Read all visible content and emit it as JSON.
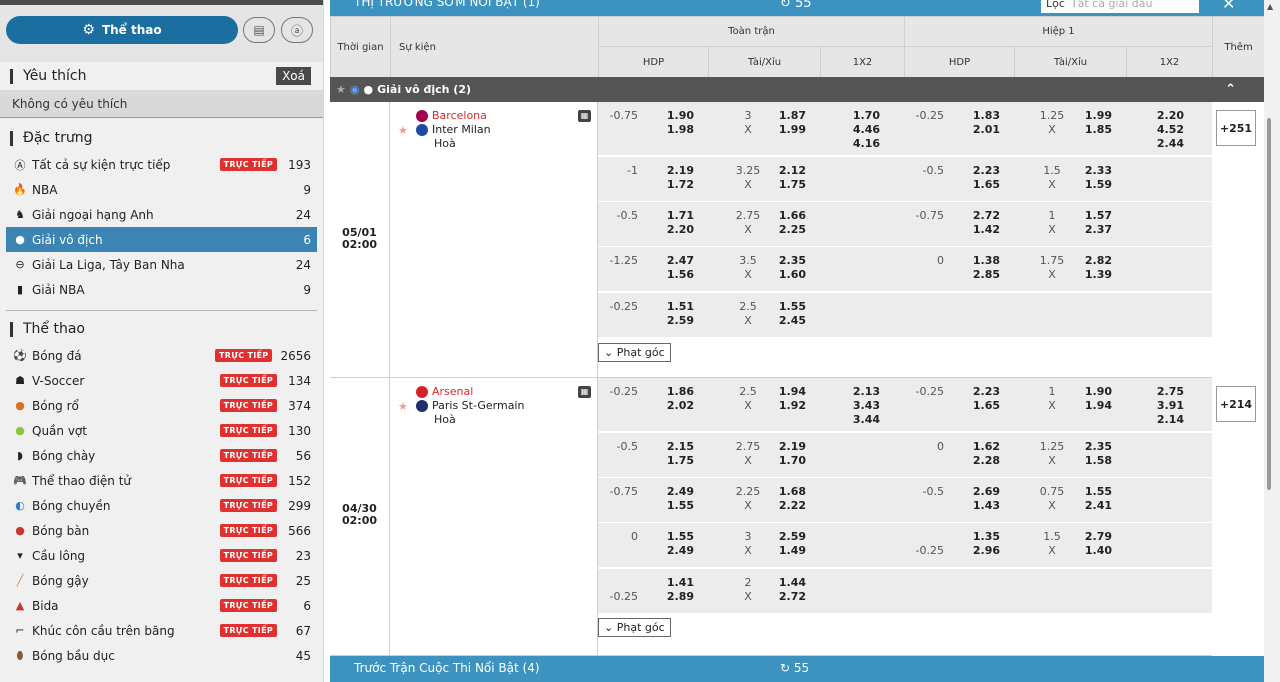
{
  "sidebar": {
    "sports_label": "Thể thao",
    "favorites_title": "Yêu thích",
    "clear_label": "Xoá",
    "no_favorites": "Không có yêu thích",
    "featured_title": "Đặc trưng",
    "featured": [
      {
        "label": "Tất cả sự kiện trực tiếp",
        "live": "TRỰC TIẾP",
        "count": "193",
        "icon": "all-icon"
      },
      {
        "label": "NBA",
        "count": "9",
        "icon": "nba-fire-icon"
      },
      {
        "label": "Giải ngoại hạng Anh",
        "count": "24",
        "icon": "premier-league-icon"
      },
      {
        "label": "Giải vô địch",
        "count": "6",
        "icon": "champions-league-icon",
        "active": true
      },
      {
        "label": "Giải La Liga, Tây Ban Nha",
        "count": "24",
        "icon": "laliga-icon"
      },
      {
        "label": "Giải NBA",
        "count": "9",
        "icon": "nba-logo-icon"
      }
    ],
    "sports_title": "Thể thao",
    "sports": [
      {
        "label": "Bóng đá",
        "live": "TRỰC TIẾP",
        "count": "2656",
        "icon": "soccer-ball-icon"
      },
      {
        "label": "V-Soccer",
        "live": "TRỰC TIẾP",
        "count": "134",
        "icon": "virtual-soccer-icon"
      },
      {
        "label": "Bóng rổ",
        "live": "TRỰC TIẾP",
        "count": "374",
        "icon": "basketball-icon"
      },
      {
        "label": "Quần vợt",
        "live": "TRỰC TIẾP",
        "count": "130",
        "icon": "tennis-ball-icon"
      },
      {
        "label": "Bóng chày",
        "live": "TRỰC TIẾP",
        "count": "56",
        "icon": "baseball-icon"
      },
      {
        "label": "Thể thao điện tử",
        "live": "TRỰC TIẾP",
        "count": "152",
        "icon": "gamepad-icon"
      },
      {
        "label": "Bóng chuyền",
        "live": "TRỰC TIẾP",
        "count": "299",
        "icon": "volleyball-icon"
      },
      {
        "label": "Bóng bàn",
        "live": "TRỰC TIẾP",
        "count": "566",
        "icon": "table-tennis-icon"
      },
      {
        "label": "Cầu lông",
        "live": "TRỰC TIẾP",
        "count": "23",
        "icon": "shuttlecock-icon"
      },
      {
        "label": "Bóng gậy",
        "live": "TRỰC TIẾP",
        "count": "25",
        "icon": "cricket-icon"
      },
      {
        "label": "Bida",
        "live": "TRỰC TIẾP",
        "count": "6",
        "icon": "billiards-icon"
      },
      {
        "label": "Khúc côn cầu trên băng",
        "live": "TRỰC TIẾP",
        "count": "67",
        "icon": "ice-hockey-icon"
      },
      {
        "label": "Bóng bầu dục",
        "count": "45",
        "icon": "rugby-ball-icon"
      }
    ]
  },
  "header": {
    "market_title": "THỊ TRƯỜNG SỚM NỔI BẬT (1)",
    "refresh_count": "55",
    "filter_label": "Lọc",
    "filter_placeholder": "Tất cả giải đấu",
    "col_time": "Thời gian",
    "col_event": "Sự kiện",
    "col_fulltime": "Toàn trận",
    "col_half1": "Hiệp 1",
    "col_more": "Thêm",
    "sub_hdp": "HDP",
    "sub_ou": "Tài/Xỉu",
    "sub_1x2": "1X2"
  },
  "league": {
    "name": "Giải vô địch (2)"
  },
  "matches": [
    {
      "date": "05/01",
      "time": "02:00",
      "home": "Barcelona",
      "away": "Inter Milan",
      "draw": "Hoà",
      "more": "+251",
      "corner": "Phạt góc",
      "rows": [
        {
          "ft_hdp": "-0.75",
          "ft_h1": "1.90",
          "ft_h2": "1.98",
          "ft_ou": "3",
          "ft_x": "X",
          "ft_o1": "1.87",
          "ft_o2": "1.99",
          "ft_1": "1.70",
          "ft_2": "4.46",
          "ft_3": "4.16",
          "h1_hdp": "-0.25",
          "h1_h1": "1.83",
          "h1_h2": "2.01",
          "h1_ou": "1.25",
          "h1_x": "X",
          "h1_o1": "1.99",
          "h1_o2": "1.85",
          "h1_1": "2.20",
          "h1_2": "4.52",
          "h1_3": "2.44"
        },
        {
          "ft_hdp": "-1",
          "ft_h1": "2.19",
          "ft_h2": "1.72",
          "ft_ou": "3.25",
          "ft_x": "X",
          "ft_o1": "2.12",
          "ft_o2": "1.75",
          "h1_hdp": "-0.5",
          "h1_h1": "2.23",
          "h1_h2": "1.65",
          "h1_ou": "1.5",
          "h1_x": "X",
          "h1_o1": "2.33",
          "h1_o2": "1.59"
        },
        {
          "ft_hdp": "-0.5",
          "ft_h1": "1.71",
          "ft_h2": "2.20",
          "ft_ou": "2.75",
          "ft_x": "X",
          "ft_o1": "1.66",
          "ft_o2": "2.25",
          "h1_hdp": "-0.75",
          "h1_h1": "2.72",
          "h1_h2": "1.42",
          "h1_ou": "1",
          "h1_x": "X",
          "h1_o1": "1.57",
          "h1_o2": "2.37"
        },
        {
          "ft_hdp": "-1.25",
          "ft_h1": "2.47",
          "ft_h2": "1.56",
          "ft_ou": "3.5",
          "ft_x": "X",
          "ft_o1": "2.35",
          "ft_o2": "1.60",
          "h1_hdp": "0",
          "h1_h1": "1.38",
          "h1_h2": "2.85",
          "h1_ou": "1.75",
          "h1_x": "X",
          "h1_o1": "2.82",
          "h1_o2": "1.39"
        },
        {
          "ft_hdp": "-0.25",
          "ft_h1": "1.51",
          "ft_h2": "2.59",
          "ft_ou": "2.5",
          "ft_x": "X",
          "ft_o1": "1.55",
          "ft_o2": "2.45"
        }
      ]
    },
    {
      "date": "04/30",
      "time": "02:00",
      "home": "Arsenal",
      "away": "Paris St-Germain",
      "draw": "Hoà",
      "more": "+214",
      "corner": "Phạt góc",
      "rows": [
        {
          "ft_hdp": "-0.25",
          "ft_h1": "1.86",
          "ft_h2": "2.02",
          "ft_ou": "2.5",
          "ft_x": "X",
          "ft_o1": "1.94",
          "ft_o2": "1.92",
          "ft_1": "2.13",
          "ft_2": "3.43",
          "ft_3": "3.44",
          "h1_hdp": "-0.25",
          "h1_h1": "2.23",
          "h1_h2": "1.65",
          "h1_ou": "1",
          "h1_x": "X",
          "h1_o1": "1.90",
          "h1_o2": "1.94",
          "h1_1": "2.75",
          "h1_2": "3.91",
          "h1_3": "2.14"
        },
        {
          "ft_hdp": "-0.5",
          "ft_h1": "2.15",
          "ft_h2": "1.75",
          "ft_ou": "2.75",
          "ft_x": "X",
          "ft_o1": "2.19",
          "ft_o2": "1.70",
          "h1_hdp": "0",
          "h1_h1": "1.62",
          "h1_h2": "2.28",
          "h1_ou": "1.25",
          "h1_x": "X",
          "h1_o1": "2.35",
          "h1_o2": "1.58"
        },
        {
          "ft_hdp": "-0.75",
          "ft_h1": "2.49",
          "ft_h2": "1.55",
          "ft_ou": "2.25",
          "ft_x": "X",
          "ft_o1": "1.68",
          "ft_o2": "2.22",
          "h1_hdp": "-0.5",
          "h1_h1": "2.69",
          "h1_h2": "1.43",
          "h1_ou": "0.75",
          "h1_x": "X",
          "h1_o1": "1.55",
          "h1_o2": "2.41"
        },
        {
          "ft_hdp": "0",
          "ft_h1": "1.55",
          "ft_h2": "2.49",
          "ft_ou": "3",
          "ft_x": "X",
          "ft_o1": "2.59",
          "ft_o2": "1.49",
          "h1_hdp": "-0.25",
          "h1_h1": "1.35",
          "h1_h2": "2.96",
          "h1_ou": "1.5",
          "h1_x": "X",
          "h1_o1": "2.79",
          "h1_o2": "1.40"
        },
        {
          "ft_hdp": "-0.25",
          "ft_h1": "1.41",
          "ft_h2": "2.89",
          "ft_ou": "2",
          "ft_x": "X",
          "ft_o1": "1.44",
          "ft_o2": "2.72"
        }
      ]
    }
  ],
  "footer": {
    "title": "Trước Trận Cuộc Thi Nổi Bật (4)",
    "refresh_count": "55"
  },
  "colors": {
    "accent": "#3c93c0",
    "active": "#3c84b3",
    "live": "#e03030",
    "pill": "#1b6fa0"
  }
}
